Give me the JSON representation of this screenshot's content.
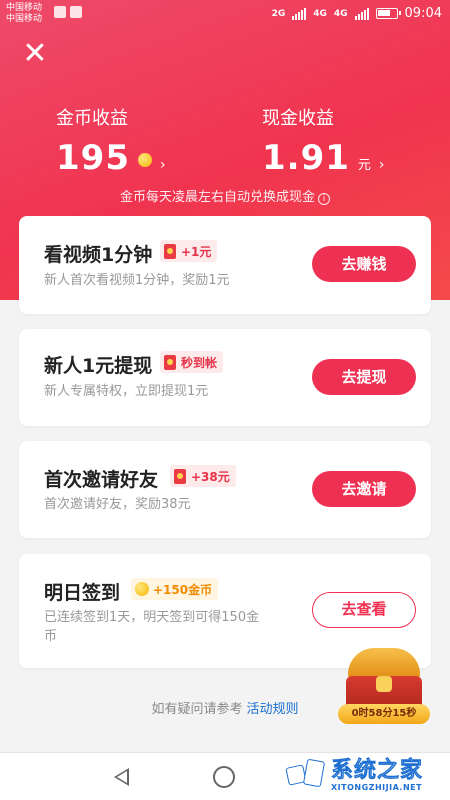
{
  "status_bar": {
    "carrier1": "中国移动",
    "carrier2": "中国移动",
    "net1": "2G",
    "net2": "4G",
    "net3": "4G",
    "time": "09:04"
  },
  "header": {
    "close_icon": "close-icon",
    "gold": {
      "label": "金币收益",
      "value": "195"
    },
    "cash": {
      "label": "现金收益",
      "value": "1.91",
      "unit": "元"
    },
    "chevron": "›",
    "exchange_note": "金币每天凌晨左右自动兑换成现金",
    "info_symbol": "i"
  },
  "tasks": [
    {
      "title": "看视频1分钟",
      "badge": "+1元",
      "badge_icon": "red-envelope-icon",
      "desc": "新人首次看视频1分钟，奖励1元",
      "button": "去赚钱"
    },
    {
      "title": "新人1元提现",
      "badge": "秒到帐",
      "badge_icon": "red-envelope-icon",
      "desc": "新人专属特权，立即提现1元",
      "button": "去提现"
    },
    {
      "title": "首次邀请好友",
      "badge": "+38元",
      "badge_icon": "red-envelope-icon",
      "desc": "首次邀请好友，奖励38元",
      "button": "去邀请"
    },
    {
      "title": "明日签到",
      "badge": "+150金币",
      "badge_icon": "gold-coin-icon",
      "desc_line1": "已连续签到1天，明天签到可得150金",
      "desc_line2": "币",
      "button": "去查看"
    }
  ],
  "rules": {
    "prefix": "如有疑问请参考",
    "link": "活动规则"
  },
  "treasure": {
    "timer": "0时58分15秒"
  },
  "watermark": {
    "cn": "系统之家",
    "en": "XITONGZHIJIA.NET"
  },
  "colors": {
    "accent": "#ee3152",
    "header": "#f0344f",
    "link": "#1a6fd0"
  }
}
